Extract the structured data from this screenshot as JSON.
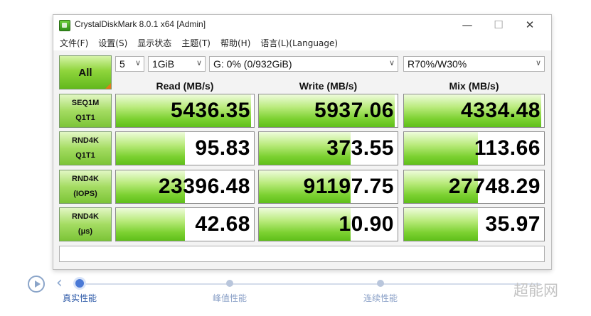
{
  "window": {
    "title": "CrystalDiskMark 8.0.1 x64 [Admin]",
    "minimize": "—",
    "maximize": "☐",
    "close": "✕"
  },
  "menu": [
    "文件(F)",
    "设置(S)",
    "显示状态",
    "主题(T)",
    "帮助(H)",
    "语言(L)(Language)"
  ],
  "controls": {
    "all_label": "All",
    "count": "5",
    "size": "1GiB",
    "drive": "G: 0% (0/932GiB)",
    "mix": "R70%/W30%"
  },
  "headers": [
    "Read (MB/s)",
    "Write (MB/s)",
    "Mix (MB/s)"
  ],
  "rows": [
    {
      "l1": "SEQ1M",
      "l2": "Q1T1",
      "read": "5436.35",
      "write": "5937.06",
      "mix": "4334.48",
      "fill": [
        0.98,
        0.98,
        0.98
      ]
    },
    {
      "l1": "RND4K",
      "l2": "Q1T1",
      "read": "95.83",
      "write": "373.55",
      "mix": "113.66",
      "fill": [
        0.5,
        0.66,
        0.53
      ]
    },
    {
      "l1": "RND4K",
      "l2": "(IOPS)",
      "read": "23396.48",
      "write": "91197.75",
      "mix": "27748.29",
      "fill": [
        0.5,
        0.66,
        0.53
      ]
    },
    {
      "l1": "RND4K",
      "l2": "(μs)",
      "read": "42.68",
      "write": "10.90",
      "mix": "35.97",
      "fill": [
        0.5,
        0.66,
        0.53
      ]
    }
  ],
  "colors": {
    "bar_green": "#7cd131",
    "accent_blue": "#4a79d6"
  },
  "bottom_nav": {
    "labels": [
      "真实性能",
      "峰值性能",
      "连续性能"
    ],
    "active_index": 0,
    "watermark": "超能网"
  }
}
